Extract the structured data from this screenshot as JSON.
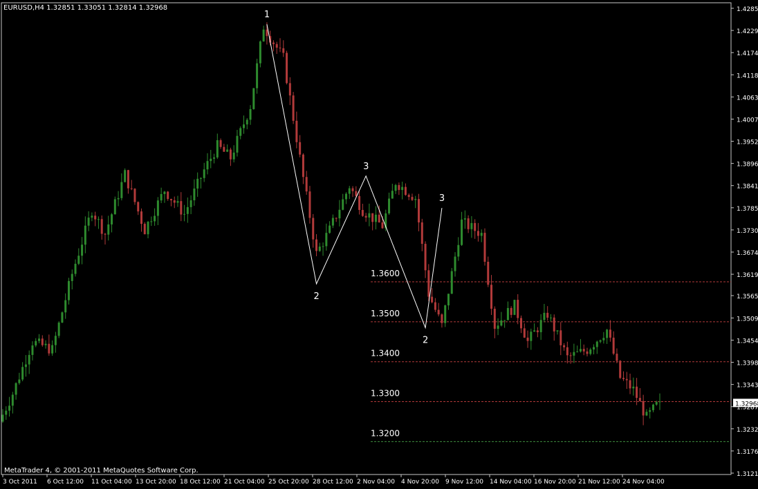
{
  "chart_header": {
    "symbol": "EURUSD,H4",
    "open": "1.32851",
    "high": "1.33051",
    "low": "1.32814",
    "close": "1.32968"
  },
  "footer": {
    "copyright": "MetaTrader 4, © 2001-2011 MetaQuotes Software Corp."
  },
  "colors": {
    "background": "#000000",
    "up": "#2e8b2e",
    "down": "#b23a3a",
    "axis_text": "#ffffff",
    "level_line": "#b33a3a",
    "level_line_last": "#3f8f3f",
    "wave": "#ffffff",
    "current_price_box": "#ffffff"
  },
  "chart_data": {
    "type": "candlestick",
    "instrument": "EURUSD",
    "timeframe": "H4",
    "current_price": 1.32968,
    "y_ticks": [
      "1.42850",
      "1.42295",
      "1.41740",
      "1.41185",
      "1.40630",
      "1.40075",
      "1.39520",
      "1.38965",
      "1.38410",
      "1.37855",
      "1.37300",
      "1.36745",
      "1.36190",
      "1.35655",
      "1.35095",
      "1.34540",
      "1.33985",
      "1.33430",
      "1.32875",
      "1.32320",
      "1.31765",
      "1.31210"
    ],
    "ylim": [
      1.3121,
      1.4285
    ],
    "x_ticks": [
      "3 Oct 2011",
      "6 Oct 12:00",
      "11 Oct 04:00",
      "13 Oct 20:00",
      "18 Oct 12:00",
      "21 Oct 04:00",
      "25 Oct 20:00",
      "28 Oct 12:00",
      "2 Nov 04:00",
      "4 Nov 20:00",
      "9 Nov 12:00",
      "14 Nov 04:00",
      "16 Nov 20:00",
      "21 Nov 12:00",
      "24 Nov 04:00"
    ],
    "levels": [
      {
        "label": "1.3600",
        "price": 1.36
      },
      {
        "label": "1.3500",
        "price": 1.35
      },
      {
        "label": "1.3400",
        "price": 1.34
      },
      {
        "label": "1.3300",
        "price": 1.33
      },
      {
        "label": "1.3200",
        "price": 1.32
      }
    ],
    "path_points": [
      [
        0,
        1.325
      ],
      [
        4,
        1.332
      ],
      [
        10,
        1.345
      ],
      [
        16,
        1.343
      ],
      [
        22,
        1.362
      ],
      [
        28,
        1.378
      ],
      [
        32,
        1.372
      ],
      [
        38,
        1.387
      ],
      [
        44,
        1.373
      ],
      [
        50,
        1.383
      ],
      [
        56,
        1.377
      ],
      [
        62,
        1.388
      ],
      [
        66,
        1.394
      ],
      [
        70,
        1.391
      ],
      [
        76,
        1.404
      ],
      [
        80,
        1.424
      ],
      [
        86,
        1.416
      ],
      [
        92,
        1.386
      ],
      [
        96,
        1.367
      ],
      [
        100,
        1.373
      ],
      [
        106,
        1.384
      ],
      [
        110,
        1.378
      ],
      [
        116,
        1.374
      ],
      [
        120,
        1.385
      ],
      [
        126,
        1.381
      ],
      [
        130,
        1.357
      ],
      [
        134,
        1.349
      ],
      [
        140,
        1.375
      ],
      [
        146,
        1.372
      ],
      [
        150,
        1.349
      ],
      [
        156,
        1.354
      ],
      [
        160,
        1.345
      ],
      [
        166,
        1.352
      ],
      [
        172,
        1.341
      ],
      [
        178,
        1.343
      ],
      [
        184,
        1.348
      ],
      [
        188,
        1.336
      ],
      [
        192,
        1.333
      ],
      [
        196,
        1.326
      ],
      [
        199,
        1.329
      ]
    ],
    "wave_labels": [
      {
        "label": "1",
        "index": 80,
        "price": 1.4245
      },
      {
        "label": "2",
        "index": 95,
        "price": 1.3595
      },
      {
        "label": "3",
        "index": 110,
        "price": 1.3865
      },
      {
        "label": "2",
        "index": 128,
        "price": 1.3485
      },
      {
        "label": "3",
        "index": 133,
        "price": 1.3785
      }
    ]
  }
}
